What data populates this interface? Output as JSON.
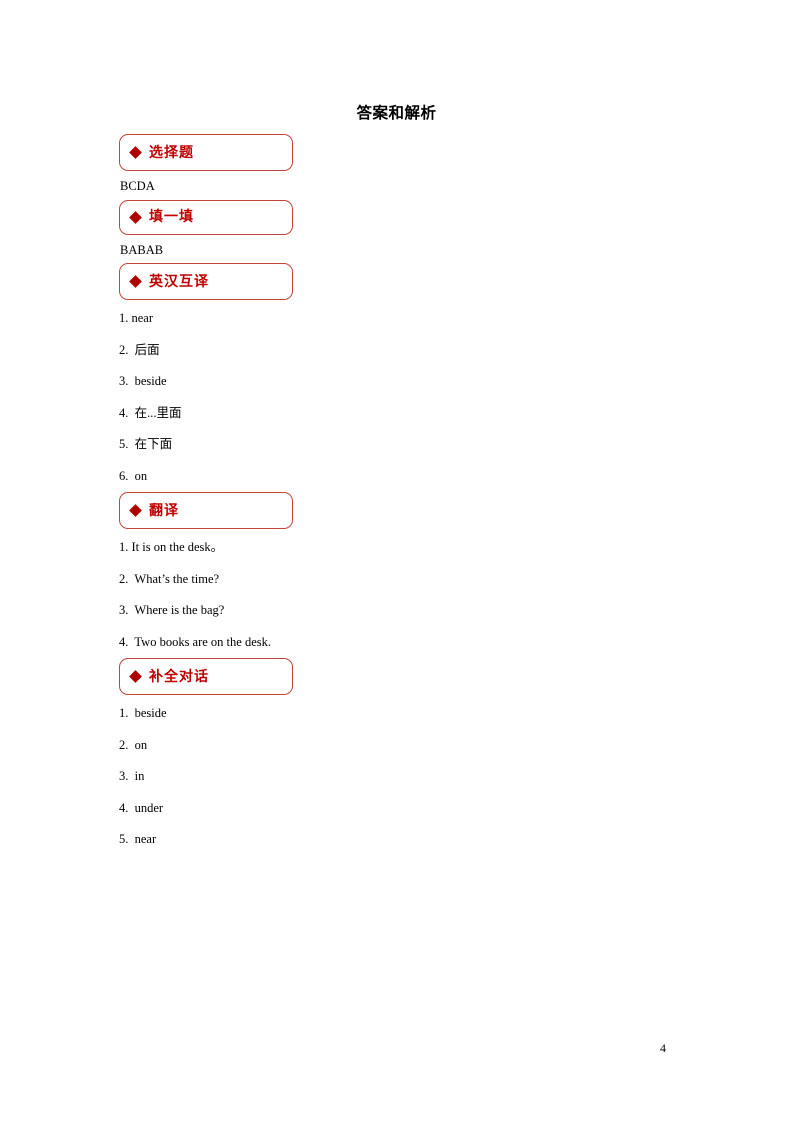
{
  "document": {
    "title": "答案和解析",
    "page_number": "4",
    "accent_border_color": "#C2453C",
    "accent_text_color": "#C00000",
    "bullet_color": "#B00000"
  },
  "sections": [
    {
      "bullet": "diamond-icon",
      "label": "选择题",
      "answer_inline": "BCDA",
      "items": []
    },
    {
      "bullet": "diamond-icon",
      "label": "填一填",
      "answer_inline": "BABAB",
      "items": []
    },
    {
      "bullet": "diamond-icon",
      "label": "英汉互译",
      "answer_inline": "",
      "items": [
        "1. near",
        "2.  后面",
        "3.  beside",
        "4.  在...里面",
        "5.  在下面",
        "6.  on"
      ]
    },
    {
      "bullet": "diamond-icon",
      "label": "翻译",
      "answer_inline": "",
      "items": [
        "1. It is on the desk。",
        "2.  What’s the time?",
        "3.  Where is the bag?",
        "4.  Two books are on the desk."
      ]
    },
    {
      "bullet": "diamond-icon",
      "label": "补全对话",
      "answer_inline": "",
      "items": [
        "1.  beside",
        "2.  on",
        "3.  in",
        "4.  under",
        "5.  near"
      ]
    }
  ]
}
